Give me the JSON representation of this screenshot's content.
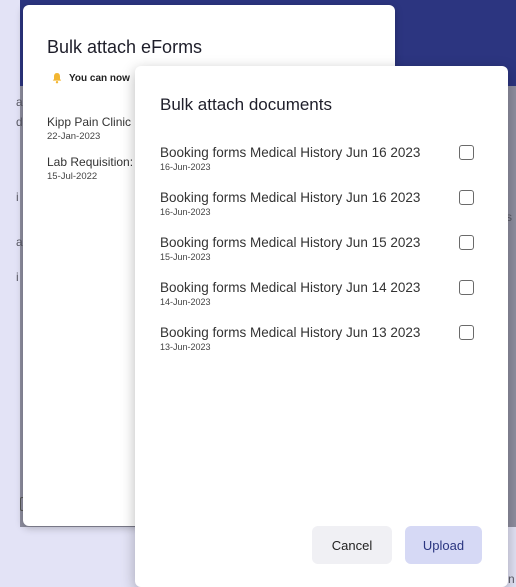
{
  "eforms_dialog": {
    "title": "Bulk attach eForms",
    "notice": "You can now",
    "items": [
      {
        "name": "Kipp Pain Clinic",
        "date": "22-Jan-2023"
      },
      {
        "name": "Lab Requisition:",
        "date": "15-Jul-2022"
      }
    ]
  },
  "docs_dialog": {
    "title": "Bulk attach documents",
    "documents": [
      {
        "name": "Booking forms Medical History Jun 16 2023",
        "date": "16-Jun-2023",
        "checked": false
      },
      {
        "name": "Booking forms Medical History Jun 16 2023",
        "date": "16-Jun-2023",
        "checked": false
      },
      {
        "name": "Booking forms Medical History Jun 15 2023",
        "date": "15-Jun-2023",
        "checked": false
      },
      {
        "name": "Booking forms Medical History Jun 14 2023",
        "date": "14-Jun-2023",
        "checked": false
      },
      {
        "name": "Booking forms Medical History Jun 13 2023",
        "date": "13-Jun-2023",
        "checked": false
      }
    ],
    "cancel_label": "Cancel",
    "upload_label": "Upload"
  },
  "background": {
    "fragments": [
      "a",
      "d",
      "i",
      "a",
      "i",
      "s",
      "c",
      "ti",
      "i",
      "n"
    ]
  },
  "colors": {
    "overlay": "#e3e3f6",
    "app_band": "#2c3580",
    "upload_button": "#d6d9f5",
    "bell": "#f2b632"
  },
  "icons": {
    "notice": "bell-icon",
    "row_select": "checkbox-icon"
  }
}
